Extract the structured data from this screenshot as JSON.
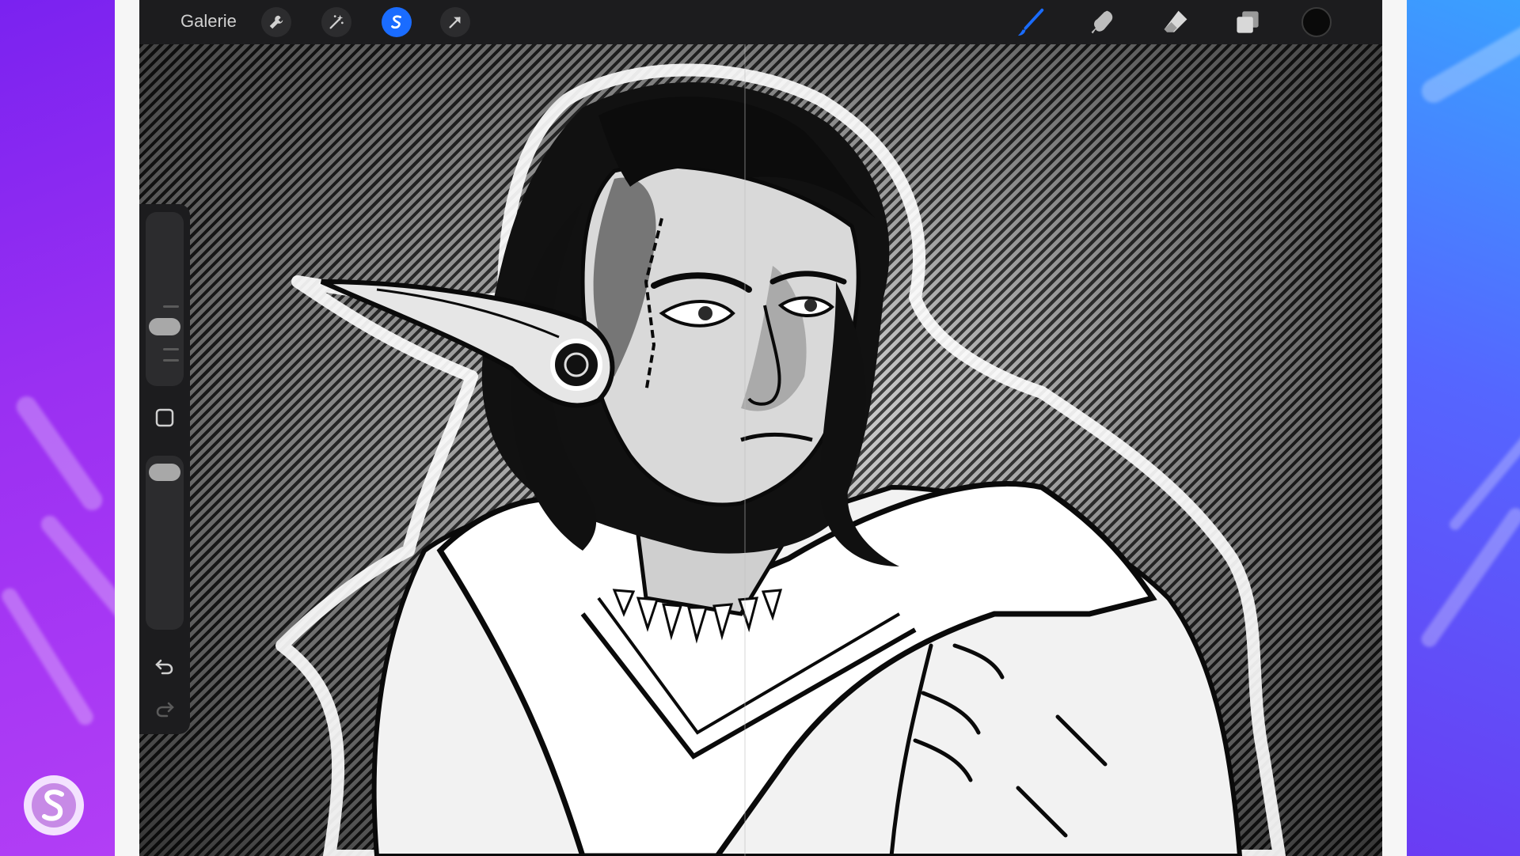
{
  "toolbar": {
    "gallery_label": "Galerie",
    "left_tools": [
      "wrench-icon",
      "magic-wand-icon",
      "selection-s-icon",
      "transform-arrow-icon"
    ],
    "active_tool": "selection-s-icon",
    "right_tools": [
      "brush-icon",
      "smudge-icon",
      "eraser-icon",
      "layers-icon"
    ],
    "current_color": "#0a0a0a",
    "accent_color": "#1a6cff"
  },
  "sidebar": {
    "brush_size_level": 0.3,
    "opacity_level": 0.92,
    "icons": [
      "modify-square-icon",
      "undo-icon",
      "redo-icon"
    ]
  },
  "canvas": {
    "artwork_description_visible": false
  },
  "brand": {
    "logo_icon": "brand-s-logo-icon"
  }
}
